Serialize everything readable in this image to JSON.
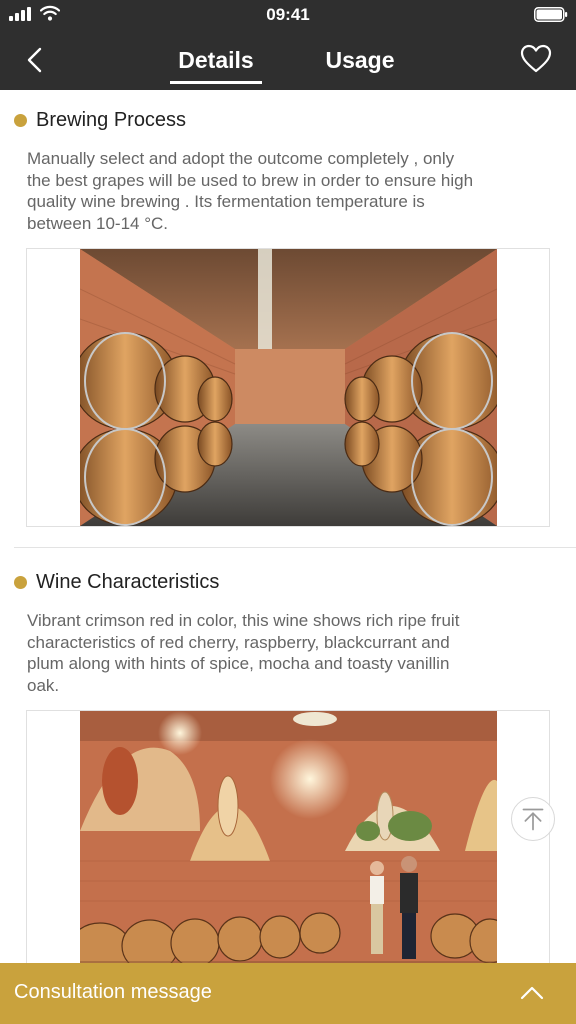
{
  "status_bar": {
    "time": "09:41",
    "signal_icon": "signal-bars-icon",
    "wifi_icon": "wifi-icon",
    "battery_icon": "battery-icon"
  },
  "nav": {
    "back_icon": "chevron-left-icon",
    "tabs": [
      {
        "label": "Details",
        "active": true
      },
      {
        "label": "Usage",
        "active": false
      }
    ],
    "favorite_icon": "heart-outline-icon"
  },
  "sections": [
    {
      "title": "Brewing Process",
      "text_lines": [
        "Manually select and adopt the outcome completely , only",
        "the best grapes will be used to brew in order to ensure high",
        "quality wine brewing . Its fermentation temperature is",
        "between 10-14 °C."
      ],
      "image_icon": "barrel-cellar-photo"
    },
    {
      "title": "Wine Characteristics",
      "text_lines": [
        "Vibrant crimson red in color, this wine shows rich ripe fruit",
        "characteristics of red cherry, raspberry, blackcurrant and",
        "plum along with hints of spice, mocha and toasty vanillin",
        "oak."
      ],
      "image_icon": "cellar-with-murals-photo"
    }
  ],
  "scroll_top_icon": "arrow-up-to-top-icon",
  "bottom_bar": {
    "label": "Consultation message",
    "icon": "chevron-up-icon"
  },
  "colors": {
    "header": "#2f2f2f",
    "accent": "#c9a23d",
    "body_text": "#666666",
    "title_text": "#222222"
  }
}
